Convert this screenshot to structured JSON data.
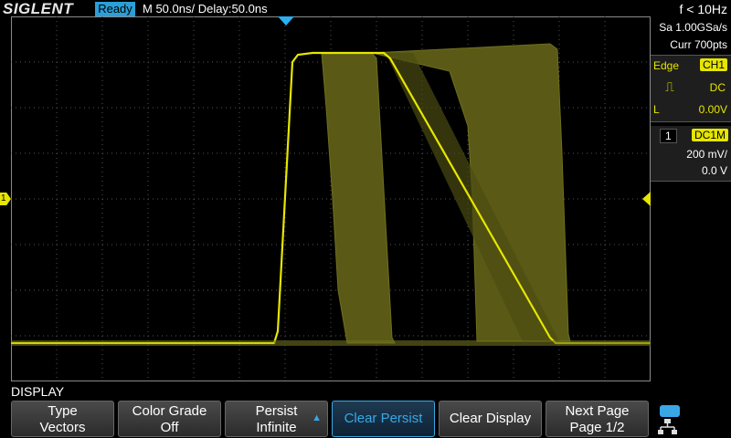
{
  "header": {
    "brand": "SIGLENT",
    "status": "Ready",
    "timebase": "M 50.0ns/  Delay:50.0ns",
    "frequency": "f < 10Hz"
  },
  "acquisition": {
    "sample_rate": "Sa 1.00GSa/s",
    "memory": "Curr 700pts"
  },
  "trigger": {
    "type_label": "Edge",
    "source": "CH1",
    "coupling": "DC",
    "level_prefix": "L",
    "level": "0.00V"
  },
  "channel": {
    "number": "1",
    "coupling": "DC1M",
    "scale": "200 mV/",
    "offset": "0.0 V"
  },
  "markers": {
    "ch1": "1"
  },
  "menu": {
    "title": "DISPLAY",
    "keys": [
      {
        "line1": "Type",
        "line2": "Vectors"
      },
      {
        "line1": "Color Grade",
        "line2": "Off"
      },
      {
        "line1": "Persist",
        "line2": "Infinite"
      },
      {
        "label": "Clear Persist"
      },
      {
        "label": "Clear Display"
      },
      {
        "line1": "Next Page",
        "line2": "Page 1/2"
      }
    ]
  },
  "colors": {
    "trace": "#e6e600",
    "persist_fill": "#5a5a16",
    "accent": "#2a9fd8"
  }
}
